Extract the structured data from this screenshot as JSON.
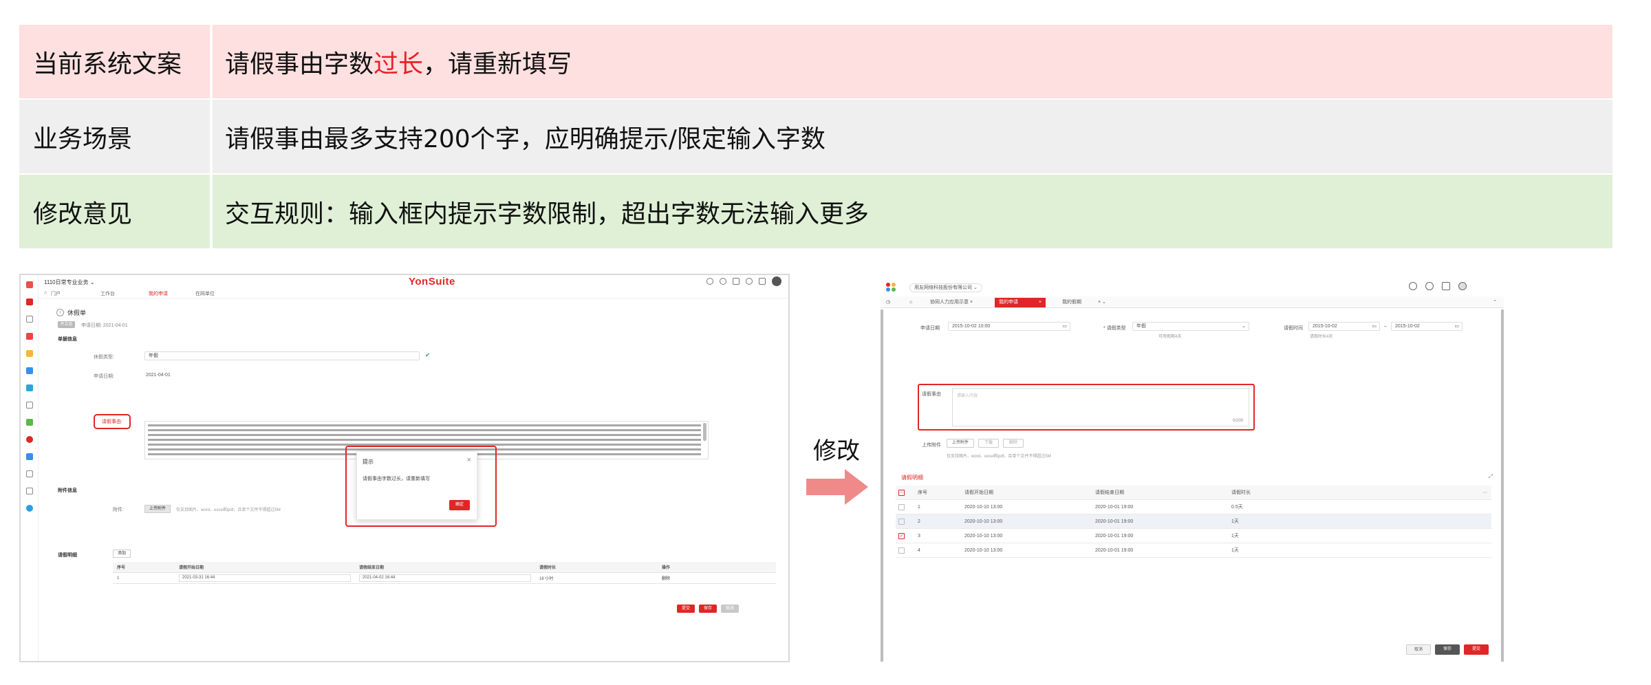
{
  "info_table": {
    "row1": {
      "label": "当前系统文案",
      "value_pre": "请假事由字数",
      "value_highlight": "过长",
      "value_post": "，请重新填写",
      "highlight_color": "#e8202a"
    },
    "row2": {
      "label": "业务场景",
      "value": "请假事由最多支持200个字，应明确提示/限定输入字数"
    },
    "row3": {
      "label": "修改意见",
      "value": "交互规则：输入框内提示字数限制，超出字数无法输入更多"
    },
    "row_colors": [
      "#fde0df",
      "#efefef",
      "#dff0d6"
    ]
  },
  "middle": {
    "label": "修改"
  },
  "left_screen": {
    "tenant": "1110日常专业业务",
    "logo": "YonSuite",
    "tabs": [
      "门户",
      "工作台",
      "我的申请",
      "在网单位"
    ],
    "active_tab": 2,
    "page_title": "休假单",
    "status_badge": "开立态",
    "apply_date_top": "申请日期: 2021-04-01",
    "section_basic": "单据信息",
    "leave_type_label": "休假类型:",
    "leave_type_value": "年假",
    "apply_date_label": "申请日期:",
    "apply_date_value": "2021-04-01",
    "reason_label": "请假事由:",
    "section_attach": "附件信息",
    "attach_label": "附件:",
    "attach_button": "上传附件",
    "attach_hint": "仅支持图片、word、excel和pdf，且单个文件不得超过5M",
    "section_detail": "请假明细",
    "add_button": "添加",
    "table": {
      "headers": [
        "序号",
        "请假开始日期",
        "请假结束日期",
        "请假时长",
        "操作"
      ],
      "rows": [
        {
          "no": "1",
          "start": "2021-03-31 16:44",
          "end": "2021-04-02 16:44",
          "duration": "16 小时",
          "op": "删除"
        }
      ]
    },
    "buttons": {
      "submit": "提交",
      "save": "保存",
      "cancel": "取消"
    },
    "dialog": {
      "title": "提示",
      "close": "×",
      "message": "请假事由字数过长，请重新填写",
      "ok": "确定"
    }
  },
  "right_screen": {
    "company": "用友网络科技股份有限公司",
    "tabs": [
      "协同人力应用示意",
      "我的申请",
      "我的假期"
    ],
    "active_tab": 1,
    "apply_date_label": "申请日期",
    "apply_date_value": "2015-10-02 10:00",
    "leave_type_label": "* 请假类型",
    "leave_type_value": "年假",
    "leave_type_hint": "可用假期4天",
    "leave_time_label": "请假时间",
    "leave_time_start": "2015-10-02",
    "leave_time_sep": "~",
    "leave_time_end": "2015-10-02",
    "leave_time_hint": "请假时长4天",
    "reason_label": "请假事由",
    "reason_placeholder": "请输入内容",
    "reason_count": "0/200",
    "attach_label": "上传附件",
    "attach_buttons": [
      "上传附件",
      "下载",
      "删除"
    ],
    "attach_hint": "仅支持图片、word、excel和pdf，且单个文件不得超过5M",
    "detail_title": "请假明细",
    "table": {
      "headers": [
        "序号",
        "请假开始日期",
        "请假结束日期",
        "请假时长"
      ],
      "rows": [
        {
          "no": "1",
          "start": "2020-10-10 13:00",
          "end": "2020-10-01 19:00",
          "duration": "0.5天",
          "checked": false
        },
        {
          "no": "2",
          "start": "2020-10-10 13:00",
          "end": "2020-10-01 19:00",
          "duration": "1天",
          "checked": false
        },
        {
          "no": "3",
          "start": "2020-10-10 13:00",
          "end": "2020-10-01 19:00",
          "duration": "1天",
          "checked": true
        },
        {
          "no": "4",
          "start": "2020-10-10 13:00",
          "end": "2020-10-01 19:00",
          "duration": "1天",
          "checked": false
        }
      ]
    },
    "buttons": {
      "cancel": "取消",
      "save": "保存",
      "submit": "提交"
    }
  }
}
